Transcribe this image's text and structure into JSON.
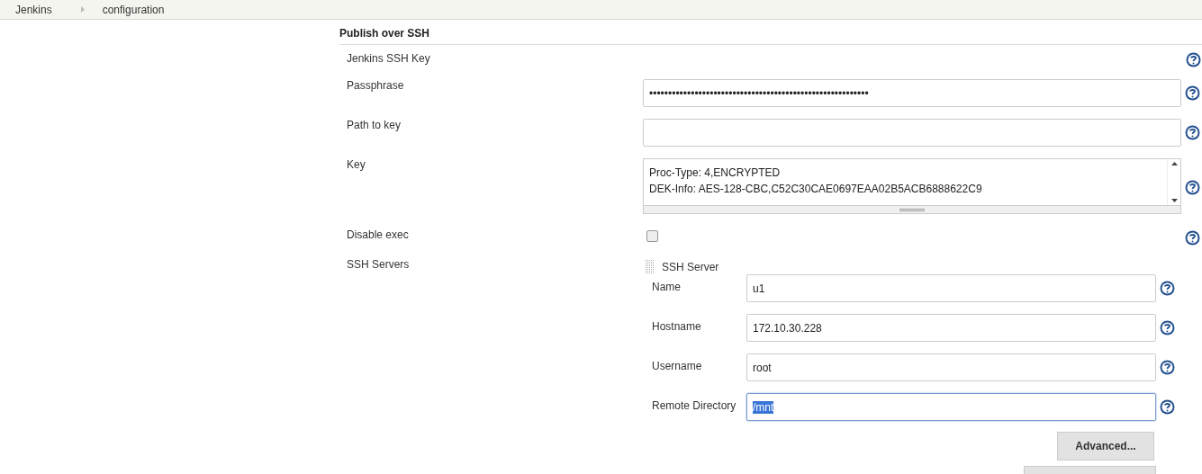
{
  "breadcrumbs": [
    {
      "label": "Jenkins"
    },
    {
      "label": "configuration"
    }
  ],
  "section": {
    "title": "Publish over SSH",
    "fields": [
      {
        "kind": "plain",
        "label": "Jenkins SSH Key"
      },
      {
        "kind": "text",
        "label": "Passphrase",
        "value": "••••••••••••••••••••••••••••••••••••••••••••••••••••••••••"
      },
      {
        "kind": "text",
        "label": "Path to key"
      },
      {
        "kind": "textarea",
        "label": "Key",
        "lines": [
          "Proc-Type: 4,ENCRYPTED",
          "DEK-Info: AES-128-CBC,C52C30CAE0697EAA02B5ACB6888622C9"
        ]
      },
      {
        "kind": "checkbox",
        "label": "Disable exec",
        "checked": false
      }
    ]
  },
  "servers": {
    "label": "SSH Servers",
    "server": {
      "title": "SSH Server",
      "fields": [
        {
          "label": "Name",
          "value": "u1",
          "focused": false
        },
        {
          "label": "Hostname",
          "value": "172.10.30.228",
          "focused": false
        },
        {
          "label": "Username",
          "value": "root",
          "focused": false
        },
        {
          "label": "Remote Directory",
          "value": "/mnt",
          "focused": true
        }
      ],
      "advanced": "Advanced..."
    }
  }
}
